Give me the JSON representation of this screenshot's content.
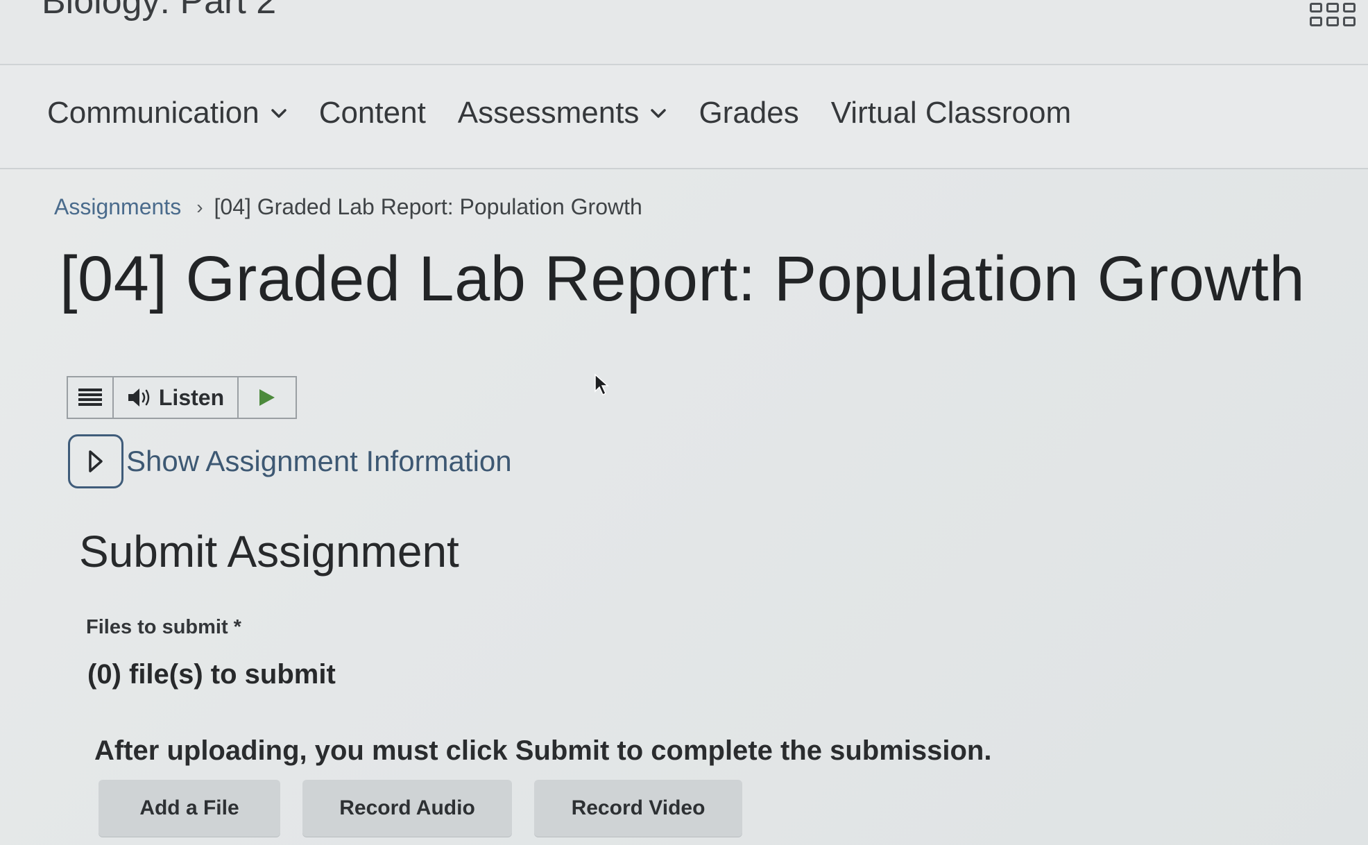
{
  "header": {
    "course_title": "Biology: Part 2",
    "apps_icon": "waffle-grid-icon"
  },
  "nav": {
    "items": [
      {
        "label": "Communication",
        "has_dropdown": true
      },
      {
        "label": "Content",
        "has_dropdown": false
      },
      {
        "label": "Assessments",
        "has_dropdown": true
      },
      {
        "label": "Grades",
        "has_dropdown": false
      },
      {
        "label": "Virtual Classroom",
        "has_dropdown": false
      }
    ]
  },
  "breadcrumb": {
    "parent": "Assignments",
    "separator": "›",
    "current": "[04] Graded Lab Report: Population Growth"
  },
  "page": {
    "title": "[04] Graded Lab Report: Population Growth"
  },
  "listen_toolbar": {
    "menu_icon": "hamburger-menu-icon",
    "listen_label": "Listen",
    "play_icon": "play-icon"
  },
  "assignment_info": {
    "toggle_label": "Show Assignment Information"
  },
  "submit": {
    "heading": "Submit Assignment",
    "files_label": "Files to submit *",
    "files_count": "(0) file(s) to submit",
    "notice": "After uploading, you must click Submit to complete the submission.",
    "buttons": {
      "add_file": "Add a File",
      "record_audio": "Record Audio",
      "record_video": "Record Video"
    }
  },
  "colors": {
    "link": "#4a6b8c",
    "accent_border": "#3f5c7a",
    "play_green": "#4c8a3c",
    "button_bg": "#cfd3d5"
  }
}
